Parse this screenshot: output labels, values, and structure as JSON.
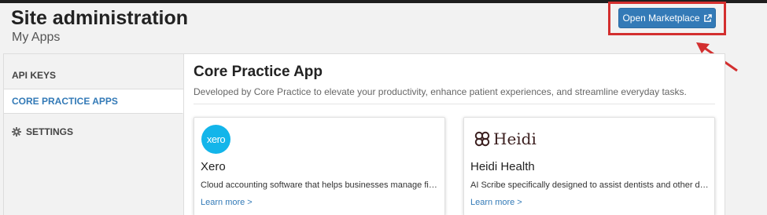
{
  "header": {
    "title": "Site administration",
    "subtitle": "My Apps",
    "marketplace_button": "Open Marketplace"
  },
  "colors": {
    "primary": "#337ab7",
    "highlight": "#d32f2f",
    "xero_brand": "#13b5ea"
  },
  "sidebar": {
    "items": [
      {
        "label": "API KEYS",
        "active": false
      },
      {
        "label": "CORE PRACTICE APPS",
        "active": true
      },
      {
        "label": "SETTINGS",
        "active": false,
        "icon": "gear-icon"
      }
    ]
  },
  "main": {
    "title": "Core Practice App",
    "description": "Developed by Core Practice to elevate your productivity, enhance patient experiences, and streamline everyday tasks.",
    "cards": [
      {
        "logo_text": "xero",
        "name": "Xero",
        "description": "Cloud accounting software that helps businesses manage finances",
        "link": "Learn more >"
      },
      {
        "logo_text": "Heidi",
        "name": "Heidi Health",
        "description": "AI Scribe specifically designed to assist dentists and other dental professionals",
        "link": "Learn more >"
      }
    ]
  }
}
